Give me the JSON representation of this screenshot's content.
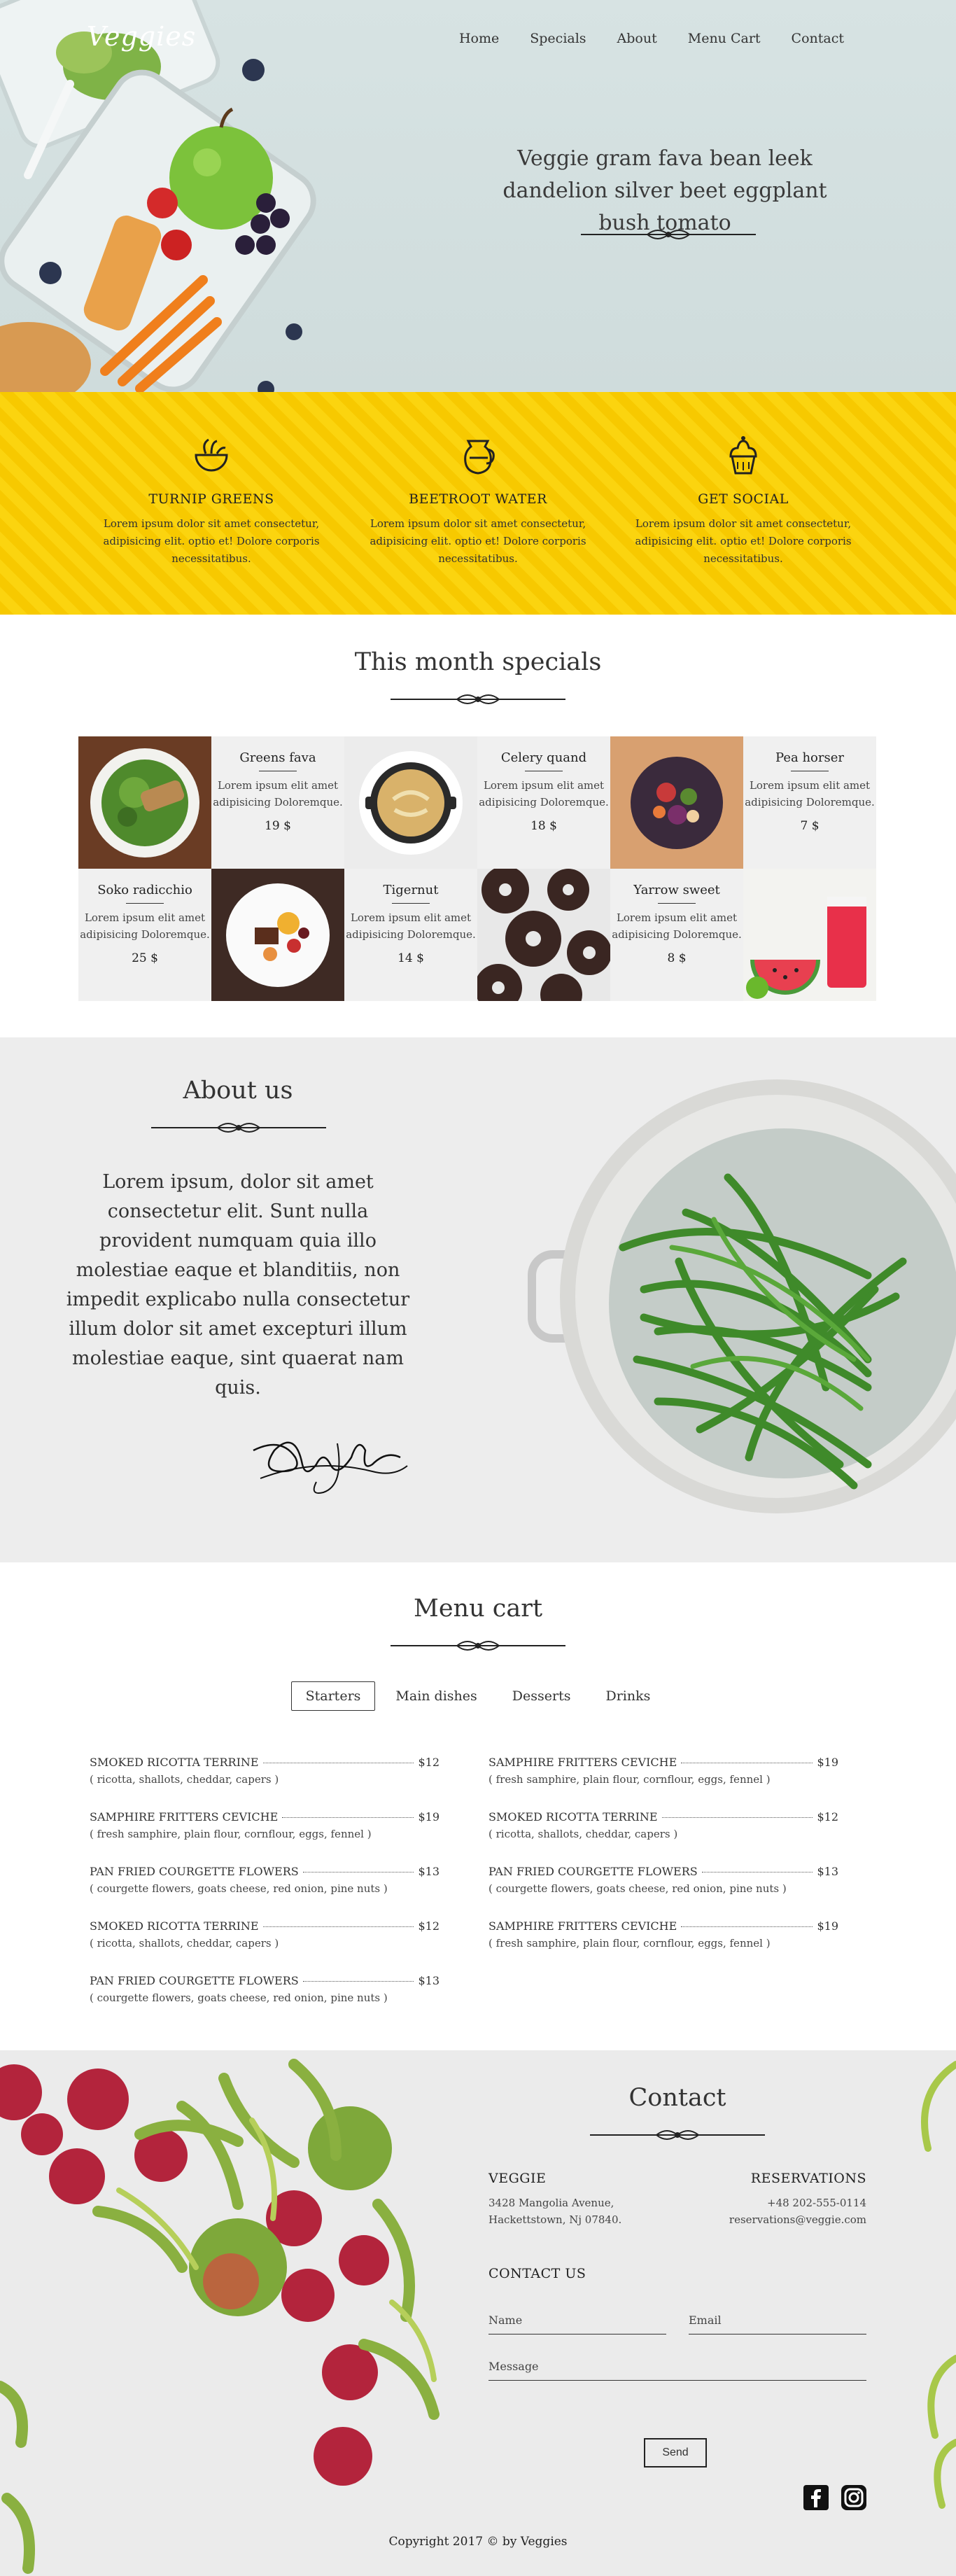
{
  "brand": {
    "logo": "Veggies"
  },
  "nav": {
    "items": [
      "Home",
      "Specials",
      "About",
      "Menu Cart",
      "Contact"
    ]
  },
  "hero": {
    "tagline": "Veggie gram fava bean leek dandelion silver beet eggplant bush tomato"
  },
  "features": [
    {
      "icon": "salad-bowl-icon",
      "title": "TURNIP GREENS",
      "text": "Lorem ipsum dolor sit amet consectetur, adipisicing elit. optio et! Dolore corporis necessitatibus."
    },
    {
      "icon": "water-jug-icon",
      "title": "BEETROOT WATER",
      "text": "Lorem ipsum dolor sit amet consectetur, adipisicing elit. optio et! Dolore corporis necessitatibus."
    },
    {
      "icon": "cupcake-icon",
      "title": "GET SOCIAL",
      "text": "Lorem ipsum dolor sit amet consectetur, adipisicing elit. optio et! Dolore corporis necessitatibus."
    }
  ],
  "specials": {
    "title": "This month specials",
    "items": [
      {
        "name": "Greens fava",
        "desc": "Lorem ipsum elit amet adipisicing Doloremque.",
        "price": "19 $",
        "image": "salad-photo"
      },
      {
        "name": "Celery quand",
        "desc": "Lorem ipsum elit amet adipisicing Doloremque.",
        "price": "18 $",
        "image": "soup-pot-photo"
      },
      {
        "name": "Pea horser",
        "desc": "Lorem ipsum elit amet adipisicing Doloremque.",
        "price": "7 $",
        "image": "veggie-bowl-photo"
      },
      {
        "name": "Soko radicchio",
        "desc": "Lorem ipsum elit amet adipisicing Doloremque.",
        "price": "25 $",
        "image": "dessert-plate-photo"
      },
      {
        "name": "Tigernut",
        "desc": "Lorem ipsum elit amet adipisicing Doloremque.",
        "price": "14 $",
        "image": "donuts-photo"
      },
      {
        "name": "Yarrow sweet",
        "desc": "Lorem ipsum elit amet adipisicing Doloremque.",
        "price": "8 $",
        "image": "watermelon-juice-photo"
      }
    ]
  },
  "about": {
    "title": "About us",
    "text": "Lorem ipsum, dolor sit amet consectetur elit. Sunt nulla provident numquam quia illo molestiae eaque et blanditiis, non impedit explicabo nulla consectetur illum dolor sit amet excepturi illum molestiae eaque, sint quaerat nam quis.",
    "signature": "Daniel Lamb"
  },
  "menu": {
    "title": "Menu cart",
    "tabs": [
      "Starters",
      "Main dishes",
      "Desserts",
      "Drinks"
    ],
    "active_tab": "Starters",
    "items": [
      {
        "name": "SMOKED RICOTTA TERRINE",
        "price": "$12",
        "desc": "( ricotta, shallots, cheddar, capers )"
      },
      {
        "name": "SAMPHIRE FRITTERS CEVICHE",
        "price": "$19",
        "desc": "( fresh samphire, plain flour, cornflour, eggs, fennel )"
      },
      {
        "name": "SAMPHIRE FRITTERS CEVICHE",
        "price": "$19",
        "desc": "( fresh samphire, plain flour, cornflour, eggs, fennel )"
      },
      {
        "name": "SMOKED RICOTTA TERRINE",
        "price": "$12",
        "desc": "( ricotta, shallots, cheddar, capers )"
      },
      {
        "name": "PAN FRIED COURGETTE FLOWERS",
        "price": "$13",
        "desc": "( courgette flowers, goats cheese, red onion, pine nuts )"
      },
      {
        "name": "PAN FRIED COURGETTE FLOWERS",
        "price": "$13",
        "desc": "( courgette flowers, goats cheese, red onion, pine nuts )"
      },
      {
        "name": "SMOKED RICOTTA TERRINE",
        "price": "$12",
        "desc": "( ricotta, shallots, cheddar, capers )"
      },
      {
        "name": "SAMPHIRE FRITTERS CEVICHE",
        "price": "$19",
        "desc": "( fresh samphire, plain flour, cornflour, eggs, fennel )"
      },
      {
        "name": "PAN FRIED COURGETTE FLOWERS",
        "price": "$13",
        "desc": "( courgette flowers, goats cheese, red onion, pine nuts )"
      }
    ]
  },
  "contact": {
    "title": "Contact",
    "veggie_label": "VEGGIE",
    "address1": "3428 Mangolia Avenue,",
    "address2": "Hackettstown, Nj 07840.",
    "reservations_label": "RESERVATIONS",
    "phone": "+48 202-555-0114",
    "email": "reservations@veggie.com",
    "form_title": "CONTACT US",
    "name_placeholder": "Name",
    "email_placeholder": "Email",
    "message_placeholder": "Message",
    "send_label": "Send"
  },
  "footer": {
    "copyright": "Copyright 2017 © by Veggies",
    "social": [
      "facebook-icon",
      "instagram-icon"
    ]
  },
  "colors": {
    "accent": "#f7c900",
    "hero_bg": "#d3dfdf",
    "section_bg": "#ededed"
  }
}
